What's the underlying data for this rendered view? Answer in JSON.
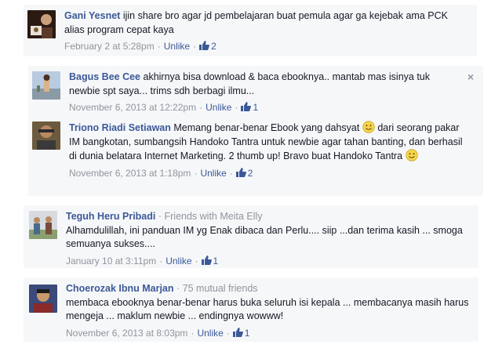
{
  "comments": [
    {
      "name": "Gani Yesnet",
      "context": "",
      "text": "ijin share bro agar jd pembelajaran buat pemula agar ga kejebak ama PCK alias program cepat kaya",
      "time": "February 2 at 5:28pm",
      "unlike": "Unlike",
      "likes": "2"
    },
    {
      "name": "Bagus Bee Cee",
      "context": "",
      "text": "akhirnya bisa download & baca ebooknya.. mantab mas isinya tuk newbie spt saya... trims sdh berbagi ilmu...",
      "time": "November 6, 2013 at 12:22pm",
      "unlike": "Unlike",
      "likes": "1",
      "close": "×"
    },
    {
      "name": "Triono Riadi Setiawan",
      "context": "",
      "text_a": "Memang benar-benar Ebook yang dahsyat",
      "text_b": "dari seorang pakar IM bangkotan, sumbangsih Handoko Tantra untuk newbie agar tahan banting, dan berhasil di dunia belatara Internet Marketing. 2 thumb up! Bravo buat Handoko Tantra",
      "time": "November 6, 2013 at 1:18pm",
      "unlike": "Unlike",
      "likes": "2"
    },
    {
      "name": "Teguh Heru Pribadi",
      "context": "· Friends with Meita Elly",
      "text": "Alhamdulillah, ini panduan IM yg Enak dibaca dan Perlu.... siip ...dan terima kasih ... smoga semuanya sukses....",
      "time": "January 10 at 3:11pm",
      "unlike": "Unlike",
      "likes": "1"
    },
    {
      "name": "Choerozak Ibnu Marjan",
      "context": "· 75 mutual friends",
      "text": "membaca ebooknya benar-benar harus buka seluruh isi kepala ... membacanya masih harus mengeja ... maklum newbie ... endingnya wowww!",
      "time": "November 6, 2013 at 8:03pm",
      "unlike": "Unlike",
      "likes": "1"
    }
  ],
  "separator": "·",
  "colors": {
    "link": "#3b5998",
    "meta": "#90949c",
    "card_bg": "#f6f7f9"
  },
  "icons": [
    "thumbs-up-icon",
    "smiley-icon",
    "close-icon"
  ]
}
